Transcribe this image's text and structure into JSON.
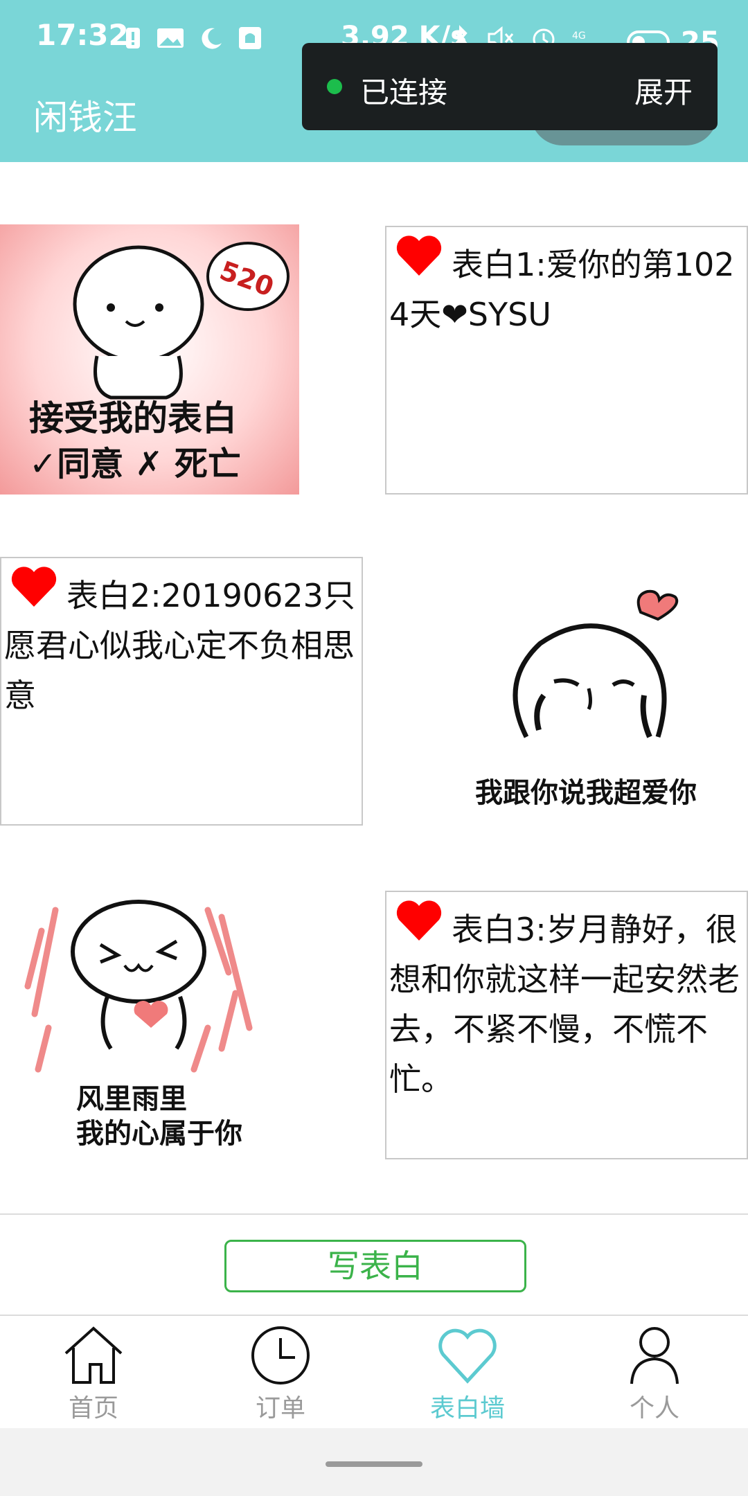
{
  "status_bar": {
    "time": "17:32",
    "net_speed": "3.92 K/s",
    "signal": "4G SIGNAL",
    "battery": "25"
  },
  "app": {
    "title": "闲钱汪",
    "accent": "#7ad6d7"
  },
  "overlay": {
    "status": "已连接",
    "expand_label": "展开",
    "dot_color": "#1cbd4c"
  },
  "wall": {
    "posts": [
      {
        "text": "表白1:爱你的第1024天❤SYSU",
        "icon": "heart-icon"
      },
      {
        "text": "表白2:20190623只愿君心似我心定不负相思意",
        "icon": "heart-icon"
      },
      {
        "text": "表白3:岁月静好，很想和你就这样一起安然老去，不紧不慢，不慌不忙。",
        "icon": "heart-icon"
      }
    ],
    "stickers": [
      {
        "caption_line1": "接受我的表白",
        "caption_line2": "✓同意 ✗ 死亡",
        "badge": "520"
      },
      {
        "caption_line1": "我跟你说我超爱你"
      },
      {
        "caption_line1": "风里雨里",
        "caption_line2": "我的心属于你"
      }
    ]
  },
  "write_button": {
    "label": "写表白",
    "color": "#3bb34a"
  },
  "tabs": [
    {
      "label": "首页",
      "icon": "home-icon",
      "active": false
    },
    {
      "label": "订单",
      "icon": "clock-icon",
      "active": false
    },
    {
      "label": "表白墙",
      "icon": "heart-outline-icon",
      "active": true
    },
    {
      "label": "个人",
      "icon": "person-icon",
      "active": false
    }
  ],
  "colors": {
    "tab_inactive": "#9a9a9a",
    "tab_active": "#5ccad0",
    "heart": "#ff0000"
  }
}
